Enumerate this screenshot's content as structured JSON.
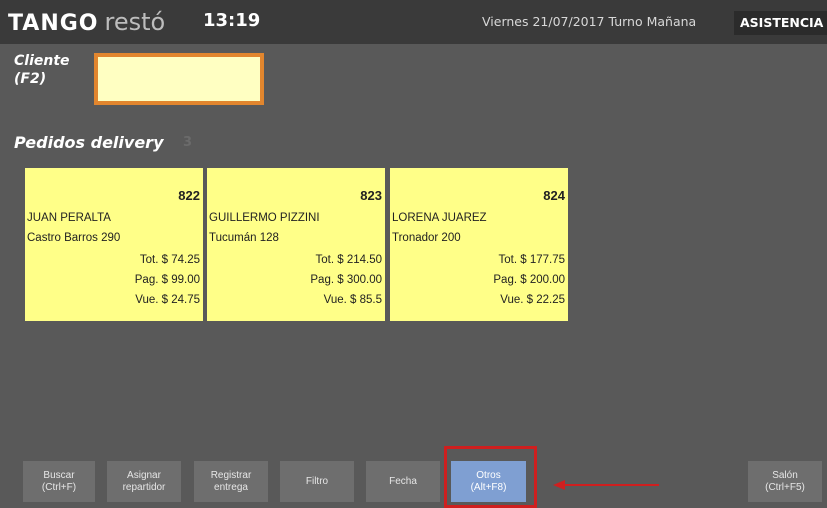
{
  "header": {
    "logo_tango": "TANGO",
    "logo_resto": "restó",
    "clock": "13:19",
    "date_info": "Viernes 21/07/2017 Turno Mañana",
    "asistencia": "ASISTENCIA"
  },
  "cliente": {
    "label": "Cliente (F2)",
    "value": ""
  },
  "pedidos": {
    "title": "Pedidos delivery",
    "count": "3",
    "orders": [
      {
        "number": "822",
        "name": "JUAN PERALTA",
        "address": "Castro Barros 290",
        "total": "Tot. $ 74.25",
        "paid": "Pag. $ 99.00",
        "change": "Vue. $ 24.75"
      },
      {
        "number": "823",
        "name": "GUILLERMO PIZZINI",
        "address": "Tucumán 128",
        "total": "Tot. $ 214.50",
        "paid": "Pag. $ 300.00",
        "change": "Vue. $ 85.5"
      },
      {
        "number": "824",
        "name": "LORENA JUAREZ",
        "address": "Tronador 200",
        "total": "Tot. $ 177.75",
        "paid": "Pag. $ 200.00",
        "change": "Vue. $ 22.25"
      }
    ]
  },
  "toolbar": {
    "buscar": "Buscar\n(Ctrl+F)",
    "asignar": "Asignar\nrepartidor",
    "registrar": "Registrar\nentrega",
    "filtro": "Filtro",
    "fecha": "Fecha",
    "otros": "Otros\n(Alt+F8)",
    "salon": "Salón\n(Ctrl+F5)"
  },
  "colors": {
    "background": "#595959",
    "card": "#ffff88",
    "input_border": "#e2862e",
    "active_button": "#7f9fd2",
    "highlight": "#cf1f1f"
  }
}
